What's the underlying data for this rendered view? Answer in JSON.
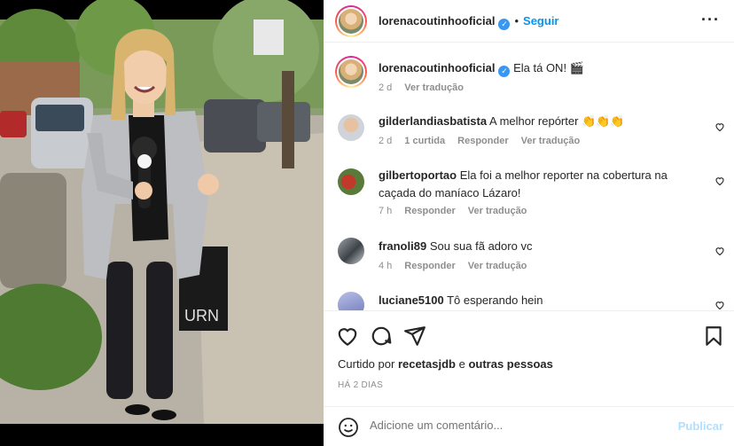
{
  "post": {
    "author": "lorenacoutinhooficial",
    "follow_label": "Seguir",
    "separator": "•",
    "more_label": "•••"
  },
  "caption": {
    "author": "lorenacoutinhooficial",
    "text": "Ela tá ON! 🎬",
    "time": "2 d",
    "translate": "Ver tradução"
  },
  "comments": [
    {
      "author": "gilderlandiasbatista",
      "text": "A melhor repórter 👏👏👏",
      "time": "2 d",
      "likes": "1 curtida",
      "reply": "Responder",
      "translate": "Ver tradução"
    },
    {
      "author": "gilbertoportao",
      "text": "Ela foi a melhor reporter na cobertura na caçada do maníaco Lázaro!",
      "time": "7 h",
      "reply": "Responder",
      "translate": "Ver tradução"
    },
    {
      "author": "franoli89",
      "text": "Sou sua fã adoro vc",
      "time": "4 h",
      "reply": "Responder",
      "translate": "Ver tradução"
    },
    {
      "author": "luciane5100",
      "text": "Tô esperando hein"
    }
  ],
  "likes": {
    "prefix": "Curtido por",
    "user": "recetasjdb",
    "connector": "e",
    "others": "outras pessoas"
  },
  "posted_ago": "HÁ 2 DIAS",
  "comment_box": {
    "placeholder": "Adicione um comentário...",
    "publish_label": "Publicar"
  },
  "colors": {
    "link": "#0095f6",
    "publish_disabled": "#b2dffc",
    "muted": "#8e8e8e",
    "verified": "#3897f0"
  },
  "photo": {
    "mic_text": "",
    "sign_text": "URN"
  }
}
